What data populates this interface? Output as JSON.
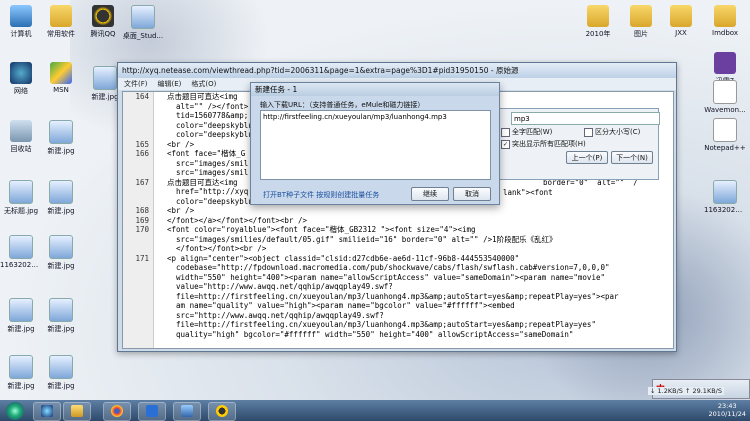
{
  "desktop": {
    "icons_left": [
      {
        "label": "计算机",
        "glyph": "g-comp"
      },
      {
        "label": "网络",
        "glyph": "g-net"
      },
      {
        "label": "回收站",
        "glyph": "g-bin"
      },
      {
        "label": "无标题.jpg",
        "glyph": "g-img"
      },
      {
        "label": "11632027...",
        "glyph": "g-img"
      },
      {
        "label": "新建.jpg",
        "glyph": "g-img"
      },
      {
        "label": "新建.jpg",
        "glyph": "g-img"
      }
    ],
    "icons_col2": [
      {
        "label": "常用软件",
        "glyph": "g-folder"
      },
      {
        "label": "MSN",
        "glyph": "g-msn"
      },
      {
        "label": "新建.jpg",
        "glyph": "g-img"
      },
      {
        "label": "新建.jpg",
        "glyph": "g-img"
      },
      {
        "label": "新建.jpg",
        "glyph": "g-img"
      },
      {
        "label": "新建.jpg",
        "glyph": "g-img"
      },
      {
        "label": "新建.jpg",
        "glyph": "g-img"
      }
    ],
    "icons_top": [
      {
        "label": "腾讯QQ",
        "glyph": "g-qq"
      },
      {
        "label": "新建.jpg",
        "glyph": "g-img"
      },
      {
        "label": "桌面_Stud...",
        "glyph": "g-img"
      }
    ],
    "icons_right": [
      {
        "label": "2010年",
        "glyph": "g-folder"
      },
      {
        "label": "图片",
        "glyph": "g-folder"
      },
      {
        "label": "JXX",
        "glyph": "g-folder"
      },
      {
        "label": "Imdbox",
        "glyph": "g-folder"
      },
      {
        "label": "迅雷7",
        "glyph": "g-xun"
      },
      {
        "label": "Wavemon...",
        "glyph": "g-doc"
      },
      {
        "label": "Notepad++",
        "glyph": "g-doc"
      },
      {
        "label": "11632027...",
        "glyph": "g-img"
      }
    ]
  },
  "browser": {
    "title": "http://xyq.netease.com/viewthread.php?tid=2006311&page=1&extra=page%3D1#pid31950150 - 原始源",
    "menu": [
      "文件(F)",
      "编辑(E)",
      "格式(O)"
    ],
    "lines": [
      {
        "num": "164",
        "text": "点击题目可直达<img"
      },
      {
        "num": "",
        "text": "  alt=\"\" /></font>"
      },
      {
        "num": "",
        "text": "  tid=1560778&amp;"
      },
      {
        "num": "",
        "text": "  color=\"deepskyblu"
      },
      {
        "num": "",
        "text": "  color=\"deepskyblu"
      },
      {
        "num": "165",
        "text": "<br />"
      },
      {
        "num": "166",
        "text": "<font face=\"楷体_G"
      },
      {
        "num": "",
        "text": "  src=\"images/smil"
      },
      {
        "num": "",
        "text": "  src=\"images/smil"
      },
      {
        "num": "167",
        "text": "点击题目可直达<img"
      },
      {
        "num": "",
        "text": "  href=\"http://xyq"
      },
      {
        "num": "",
        "text": "  color=\"deepskyblu"
      },
      {
        "num": "168",
        "text": "<br />"
      },
      {
        "num": "169",
        "text": "</font></a></font></font><br />"
      },
      {
        "num": "170",
        "text": "<font color=\"royalblue\"><font face=\"楷体_GB2312 \"><font size=\"4\"><img"
      },
      {
        "num": "",
        "text": "  src=\"images/smilies/default/05.gif\" smilieid=\"16\" border=\"0\" alt=\"\" />1阶段配乐《乱红》"
      },
      {
        "num": "",
        "text": "  </font></font><br />"
      },
      {
        "num": "171",
        "text": "<p align=\"center\"><object classid=\"clsid:d27cdb6e-ae6d-11cf-96b8-444553540000\""
      },
      {
        "num": "",
        "text": "  codebase=\"http://fpdownload.macromedia.com/pub/shockwave/cabs/flash/swflash.cab#version=7,0,0,0\""
      },
      {
        "num": "",
        "text": "  width=\"550\" height=\"400\"><param name=\"allowScriptAccess\" value=\"sameDomain\"><param name=\"movie\""
      },
      {
        "num": "",
        "text": "  value=\"http://www.awqq.net/qqhip/awqqplay49.swf?"
      },
      {
        "num": "",
        "text": "  file=http://firstfeeling.cn/xueyoulan/mp3/luanhong4.mp3&amp;autoStart=yes&amp;repeatPlay=yes\"><par"
      },
      {
        "num": "",
        "text": "  am name=\"quality\" value=\"high\"><param name=\"bgcolor\" value=\"#ffffff\"><embed"
      },
      {
        "num": "",
        "text": "  src=\"http://www.awqq.net/qqhip/awqqplay49.swf?"
      },
      {
        "num": "",
        "text": "  file=http://firstfeeling.cn/xueyoulan/mp3/luanhong4.mp3&amp;autoStart=yes&amp;repeatPlay=yes\""
      },
      {
        "num": "",
        "text": "  quality=\"high\" bgcolor=\"#ffffff\" width=\"550\" height=\"400\" allowScriptAccess=\"sameDomain\""
      }
    ],
    "partial_line_167": "border=\"0\"  alt=\"\"  /",
    "partial_line_167b": "lank\"><font"
  },
  "find": {
    "value": "mp3",
    "whole_word": "全字匹配(W)",
    "match_case": "区分大小写(C)",
    "highlight_all": "突出显示所有匹配项(H)",
    "prev": "上一个(P)",
    "next": "下一个(N)"
  },
  "dialog": {
    "title": "新建任务 - 1",
    "prompt": "输入下载URL：（支持普通任务，eMule和磁力链接）",
    "url": "http://firstfeeling.cn/xueyoulan/mp3/luanhong4.mp3",
    "bt_link": "打开BT种子文件  按规则创建批量任务",
    "continue": "继续",
    "cancel": "取消"
  },
  "tray": {
    "ime": "中",
    "speed": "↓ 1.2KB/S  ↑ 29.1KB/S",
    "time": "23:43",
    "date": "2010/11/24"
  }
}
